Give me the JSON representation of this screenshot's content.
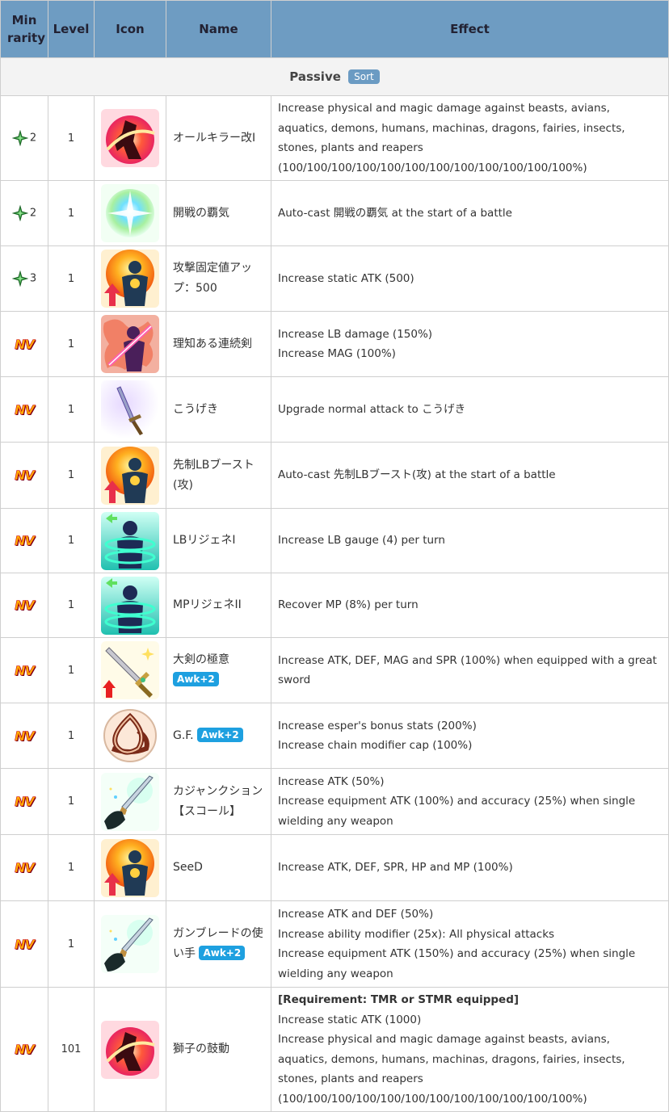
{
  "table": {
    "caption": "Passive",
    "sort_label": "Sort",
    "headers": {
      "min_rarity": "Min rarity",
      "level": "Level",
      "icon": "Icon",
      "name": "Name",
      "effect": "Effect"
    }
  },
  "rows": [
    {
      "rarity": {
        "type": "star",
        "value": "2"
      },
      "level": "1",
      "icon": "red-fire-slash-icon",
      "name": "オールキラー改I",
      "awk": "",
      "effects": [
        {
          "text": "Increase physical and magic damage against beasts, avians, aquatics, demons, humans, machinas, dragons, fairies, insects, stones, plants and reapers (100/100/100/100/100/100/100/100/100/100/100/100%)",
          "bold": false
        }
      ]
    },
    {
      "rarity": {
        "type": "star",
        "value": "2"
      },
      "level": "1",
      "icon": "green-burst-orb-icon",
      "name": "開戦の覇気",
      "awk": "",
      "effects": [
        {
          "text": "Auto-cast 開戦の覇気 at the start of a battle",
          "bold": false
        }
      ]
    },
    {
      "rarity": {
        "type": "star",
        "value": "3"
      },
      "level": "1",
      "icon": "orange-aura-figure-icon",
      "name": "攻撃固定値アップ：500",
      "awk": "",
      "effects": [
        {
          "text": "Increase static ATK (500)",
          "bold": false
        }
      ]
    },
    {
      "rarity": {
        "type": "nv",
        "value": "NV"
      },
      "level": "1",
      "icon": "pink-sword-figure-icon",
      "name": "理知ある連続剣",
      "awk": "",
      "effects": [
        {
          "text": "Increase LB damage (150%)",
          "bold": false
        },
        {
          "text": "Increase MAG (100%)",
          "bold": false
        }
      ]
    },
    {
      "rarity": {
        "type": "nv",
        "value": "NV"
      },
      "level": "1",
      "icon": "purple-sword-icon",
      "name": "こうげき",
      "awk": "",
      "effects": [
        {
          "text": "Upgrade normal attack to こうげき",
          "bold": false
        }
      ]
    },
    {
      "rarity": {
        "type": "nv",
        "value": "NV"
      },
      "level": "1",
      "icon": "orange-aura-figure-icon",
      "name": "先制LBブースト(攻)",
      "awk": "",
      "effects": [
        {
          "text": "Auto-cast 先制LBブースト(攻) at the start of a battle",
          "bold": false
        }
      ]
    },
    {
      "rarity": {
        "type": "nv",
        "value": "NV"
      },
      "level": "1",
      "icon": "teal-regen-figure-icon",
      "name": "LBリジェネI",
      "awk": "",
      "effects": [
        {
          "text": "Increase LB gauge (4) per turn",
          "bold": false
        }
      ]
    },
    {
      "rarity": {
        "type": "nv",
        "value": "NV"
      },
      "level": "1",
      "icon": "teal-regen-figure-icon",
      "name": "MPリジェネII",
      "awk": "",
      "effects": [
        {
          "text": "Recover MP (8%) per turn",
          "bold": false
        }
      ]
    },
    {
      "rarity": {
        "type": "nv",
        "value": "NV"
      },
      "level": "1",
      "icon": "great-sword-up-icon",
      "name": "大剣の極意",
      "awk": "Awk+2",
      "effects": [
        {
          "text": "Increase ATK, DEF, MAG and SPR (100%) when equipped with a great sword",
          "bold": false
        }
      ]
    },
    {
      "rarity": {
        "type": "nv",
        "value": "NV"
      },
      "level": "1",
      "icon": "triquetra-knot-icon",
      "name": "G.F.",
      "awk": "Awk+2",
      "effects": [
        {
          "text": "Increase esper's bonus stats (200%)",
          "bold": false
        },
        {
          "text": "Increase chain modifier cap (100%)",
          "bold": false
        }
      ]
    },
    {
      "rarity": {
        "type": "nv",
        "value": "NV"
      },
      "level": "1",
      "icon": "gunblade-hand-icon",
      "name": "カジャンクション【スコール】",
      "awk": "",
      "effects": [
        {
          "text": "Increase ATK (50%)",
          "bold": false
        },
        {
          "text": "Increase equipment ATK (100%) and accuracy (25%) when single wielding any weapon",
          "bold": false
        }
      ]
    },
    {
      "rarity": {
        "type": "nv",
        "value": "NV"
      },
      "level": "1",
      "icon": "orange-aura-figure-icon",
      "name": "SeeD",
      "awk": "",
      "effects": [
        {
          "text": "Increase ATK, DEF, SPR, HP and MP (100%)",
          "bold": false
        }
      ]
    },
    {
      "rarity": {
        "type": "nv",
        "value": "NV"
      },
      "level": "1",
      "icon": "gunblade-hand-icon",
      "name": "ガンブレードの使い手",
      "awk": "Awk+2",
      "effects": [
        {
          "text": "Increase ATK and DEF (50%)",
          "bold": false
        },
        {
          "text": "Increase ability modifier (25x): All physical attacks",
          "bold": false
        },
        {
          "text": "Increase equipment ATK (150%) and accuracy (25%) when single wielding any weapon",
          "bold": false
        }
      ]
    },
    {
      "rarity": {
        "type": "nv",
        "value": "NV"
      },
      "level": "101",
      "icon": "red-fire-slash-icon",
      "name": "獅子の鼓動",
      "awk": "",
      "effects": [
        {
          "text": "[Requirement: TMR or STMR equipped]",
          "bold": true
        },
        {
          "text": "Increase static ATK (1000)",
          "bold": false
        },
        {
          "text": "Increase physical and magic damage against beasts, avians, aquatics, demons, humans, machinas, dragons, fairies, insects, stones, plants and reapers (100/100/100/100/100/100/100/100/100/100/100/100%)",
          "bold": false
        }
      ]
    }
  ]
}
